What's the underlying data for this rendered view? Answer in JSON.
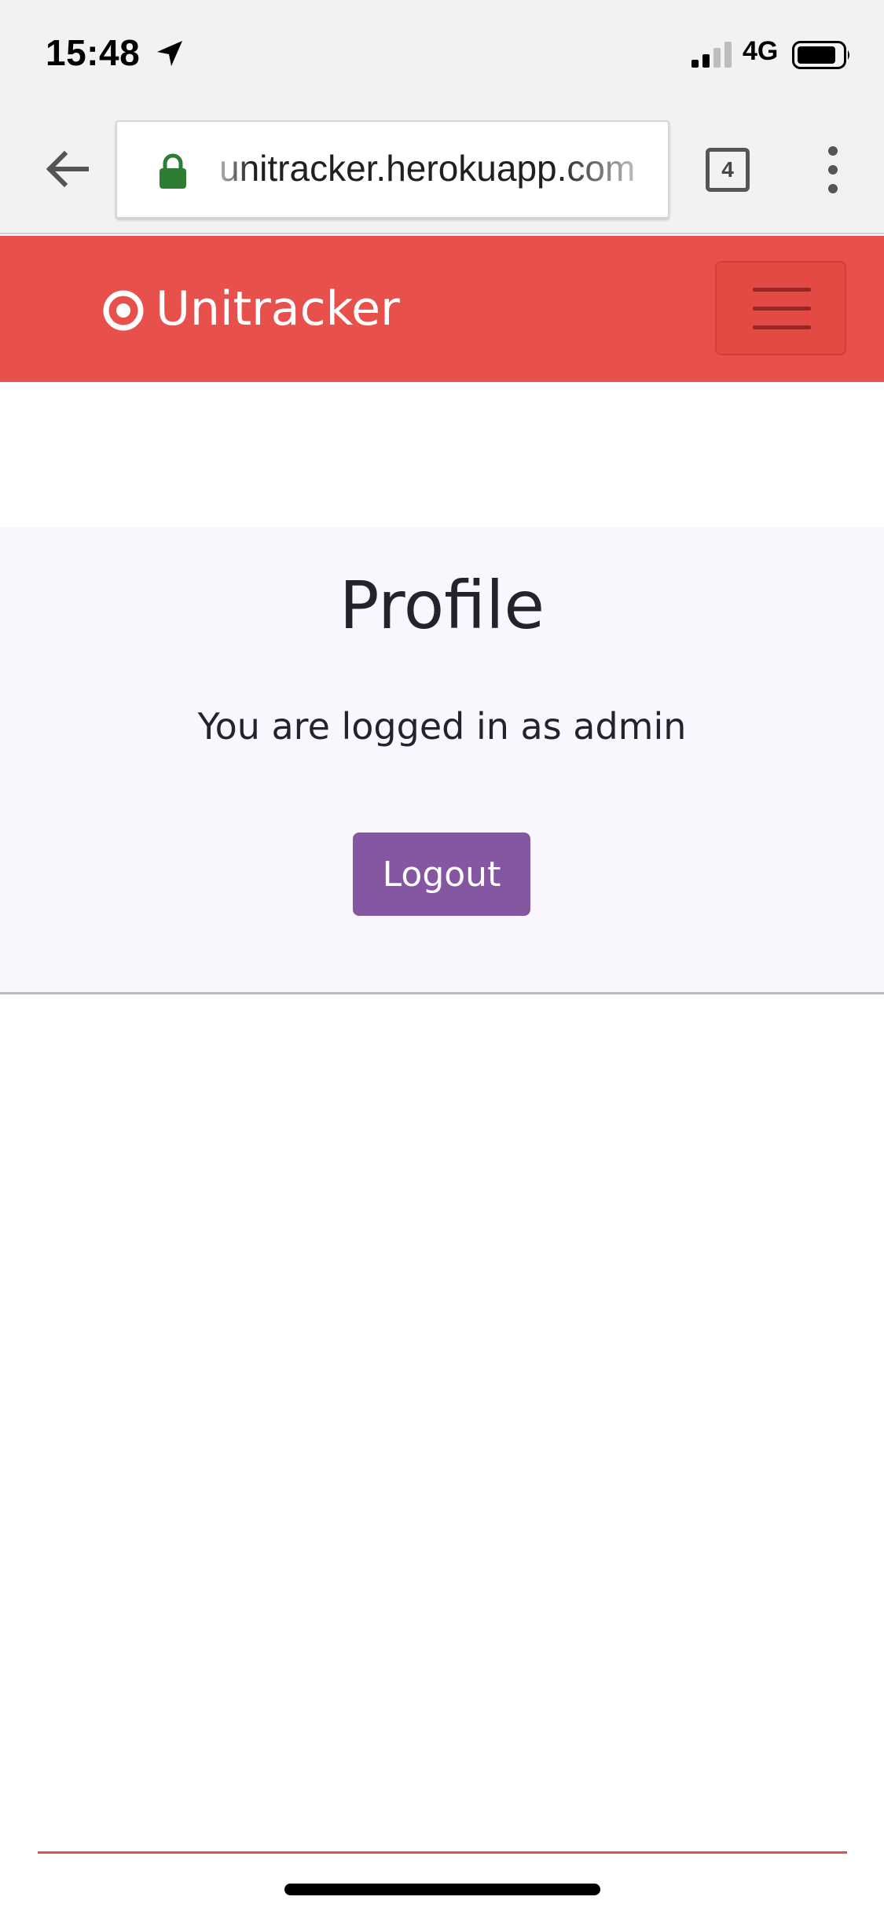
{
  "status_bar": {
    "time": "15:48",
    "network": "4G",
    "icons": [
      "location-arrow-icon",
      "signal-icon",
      "battery-icon"
    ]
  },
  "browser": {
    "url": "unitracker.herokuapp.com",
    "tab_count": "4",
    "icons": [
      "back-arrow-icon",
      "lock-icon",
      "overflow-menu-icon"
    ],
    "lock_color": "#2e7d32"
  },
  "navbar": {
    "brand": "Unitracker",
    "brand_icon": "target-icon",
    "toggle_icon": "hamburger-icon",
    "color": "#e8514b"
  },
  "profile": {
    "title": "Profile",
    "status_text": "You are logged in as admin",
    "logout_label": "Logout",
    "button_color": "#8557a2"
  }
}
